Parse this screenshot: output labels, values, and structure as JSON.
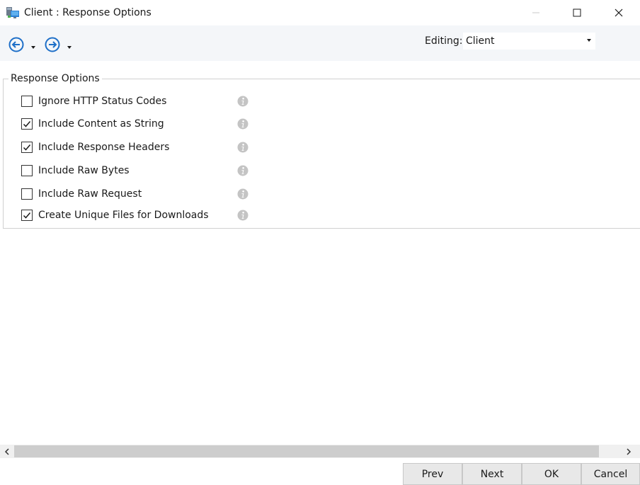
{
  "window": {
    "title": "Client : Response Options",
    "controls": {
      "minimize": "minimize-icon",
      "maximize": "maximize-icon",
      "close": "close-icon"
    }
  },
  "toolbar": {
    "back_icon": "arrow-left-circle-icon",
    "forward_icon": "arrow-right-circle-icon",
    "editing_label": "Editing:",
    "editing_value": "Client"
  },
  "group": {
    "legend": "Response Options",
    "options": [
      {
        "label": "Ignore HTTP Status Codes",
        "checked": false
      },
      {
        "label": "Include Content as String",
        "checked": true
      },
      {
        "label": "Include Response Headers",
        "checked": true
      },
      {
        "label": "Include Raw Bytes",
        "checked": false
      },
      {
        "label": "Include Raw Request",
        "checked": false
      },
      {
        "label": "Create Unique Files for Downloads",
        "checked": true
      }
    ]
  },
  "buttons": {
    "prev": "Prev",
    "next": "Next",
    "ok": "OK",
    "cancel": "Cancel"
  },
  "colors": {
    "toolbar_bg": "#f4f6f9",
    "accent_blue": "#1e6fc8",
    "info_gray": "#c0c0c0"
  }
}
